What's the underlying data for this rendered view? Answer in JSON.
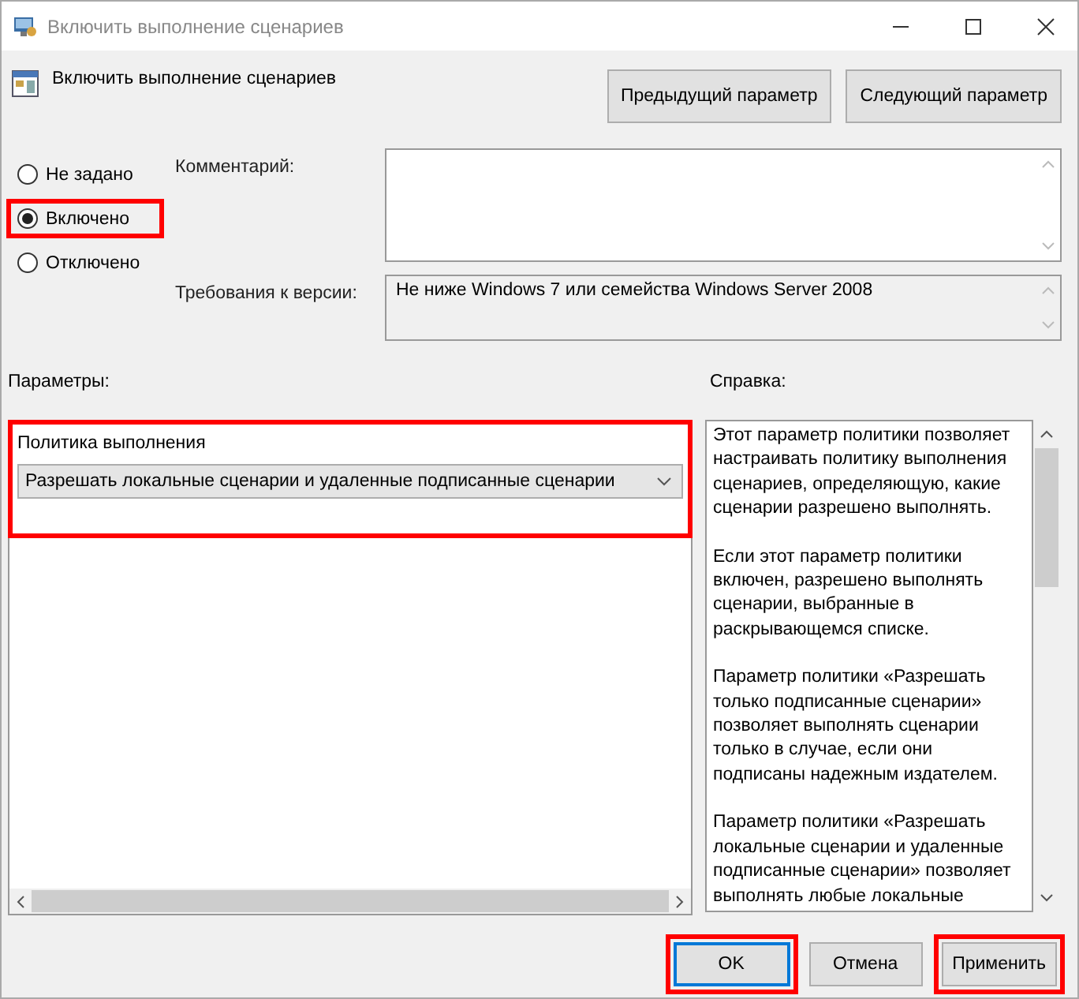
{
  "window": {
    "title": "Включить выполнение сценариев"
  },
  "header": {
    "title": "Включить выполнение сценариев"
  },
  "nav_buttons": [
    {
      "label": "Предыдущий параметр"
    },
    {
      "label": "Следующий параметр"
    }
  ],
  "radios": [
    {
      "label": "Не задано",
      "selected": false,
      "highlighted": false
    },
    {
      "label": "Включено",
      "selected": true,
      "highlighted": true
    },
    {
      "label": "Отключено",
      "selected": false,
      "highlighted": false
    }
  ],
  "comment": {
    "label": "Комментарий:"
  },
  "requirements": {
    "label": "Требования к версии:",
    "value": "Не ниже Windows 7 или семейства Windows Server 2008"
  },
  "options": {
    "label": "Параметры:",
    "highlighted": true,
    "field_label": "Политика выполнения",
    "dropdown_value": "Разрешать локальные сценарии и удаленные подписанные сценарии"
  },
  "help": {
    "label": "Справка:",
    "paragraphs": [
      "Этот параметр политики позволяет настраивать политику выполнения сценариев, определяющую, какие сценарии разрешено выполнять.",
      "Если этот параметр политики включен, разрешено выполнять сценарии, выбранные в раскрывающемся списке.",
      "Параметр политики «Разрешать только подписанные сценарии» позволяет выполнять сценарии только в случае, если они подписаны надежным издателем.",
      "Параметр политики «Разрешать локальные сценарии и удаленные подписанные сценарии» позволяет выполнять любые локальные"
    ]
  },
  "buttons": [
    {
      "label": "OK",
      "default": true,
      "highlighted": true
    },
    {
      "label": "Отмена",
      "default": false,
      "highlighted": false
    },
    {
      "label": "Применить",
      "default": false,
      "highlighted": true
    }
  ]
}
